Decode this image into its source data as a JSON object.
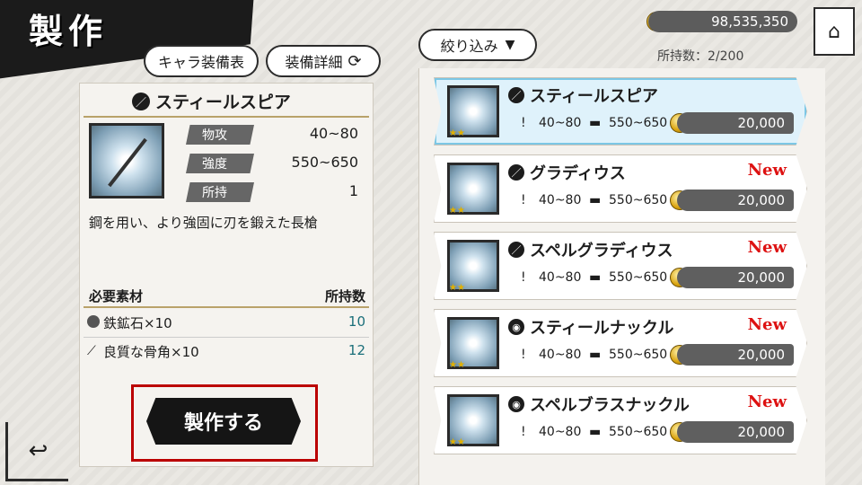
{
  "header": {
    "title": "製作"
  },
  "top_buttons": {
    "chara_equipment": "キャラ装備表",
    "equipment_detail": "装備詳細",
    "filter": "絞り込み"
  },
  "status": {
    "money": "98,535,350",
    "possession_label": "所持数：2/200"
  },
  "selected": {
    "name": "スティールスピア",
    "stats": [
      {
        "label": "物攻",
        "value": "40~80"
      },
      {
        "label": "強度",
        "value": "550~650"
      },
      {
        "label": "所持",
        "value": "1"
      }
    ],
    "description": "鋼を用い、より強固に刃を鍛えた長槍",
    "materials_header": {
      "left": "必要素材",
      "right": "所持数"
    },
    "materials": [
      {
        "name": "鉄鉱石×10",
        "count": "10"
      },
      {
        "name": "良質な骨角×10",
        "count": "12"
      }
    ],
    "craft_button": "製作する"
  },
  "list": [
    {
      "name": "スティールスピア",
      "new": "",
      "atk": "40~80",
      "dur": "550~650",
      "price": "20,000",
      "selected": true
    },
    {
      "name": "グラディウス",
      "new": "New",
      "atk": "40~80",
      "dur": "550~650",
      "price": "20,000",
      "selected": false
    },
    {
      "name": "スペルグラディウス",
      "new": "New",
      "atk": "40~80",
      "dur": "550~650",
      "price": "20,000",
      "selected": false
    },
    {
      "name": "スティールナックル",
      "new": "New",
      "atk": "40~80",
      "dur": "550~650",
      "price": "20,000",
      "selected": false
    },
    {
      "name": "スペルブラスナックル",
      "new": "New",
      "atk": "40~80",
      "dur": "550~650",
      "price": "20,000",
      "selected": false
    }
  ]
}
